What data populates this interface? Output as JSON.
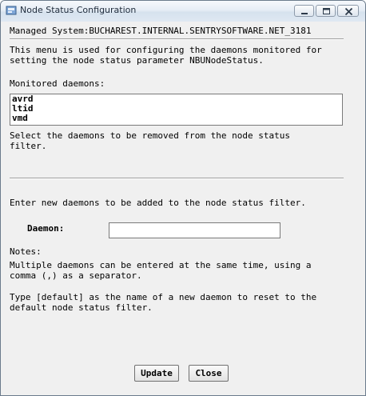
{
  "window": {
    "title": "Node Status Configuration",
    "controls": {
      "minimize_icon": "minimize-icon",
      "maximize_icon": "maximize-icon",
      "close_icon": "close-icon"
    }
  },
  "header": {
    "managed_system": "Managed System:BUCHAREST.INTERNAL.SENTRYSOFTWARE.NET_3181"
  },
  "description": {
    "line1": "This menu is used for configuring the daemons monitored for",
    "line2": "setting the node status parameter NBUNodeStatus."
  },
  "monitored": {
    "label": "Monitored daemons:",
    "items": [
      "avrd",
      "ltid",
      "vmd"
    ],
    "hint_line1": "Select the daemons to be removed from the node status",
    "hint_line2": "filter."
  },
  "add": {
    "instruction": "Enter new daemons to be added to the node status filter.",
    "daemon_label": "Daemon:",
    "daemon_value": ""
  },
  "notes": {
    "label": "Notes:",
    "line1": "Multiple daemons can be entered at the same time, using a",
    "line2": "comma (,) as a separator.",
    "line3": "Type [default] as the name of a new daemon to reset to the",
    "line4": "default node status filter."
  },
  "buttons": {
    "update": "Update",
    "close": "Close"
  },
  "colors": {
    "titlebar_top": "#f6f9fc",
    "titlebar_bottom": "#d6e2ee",
    "dialog_bg": "#f0f0f0",
    "close_button": "#c75050"
  }
}
